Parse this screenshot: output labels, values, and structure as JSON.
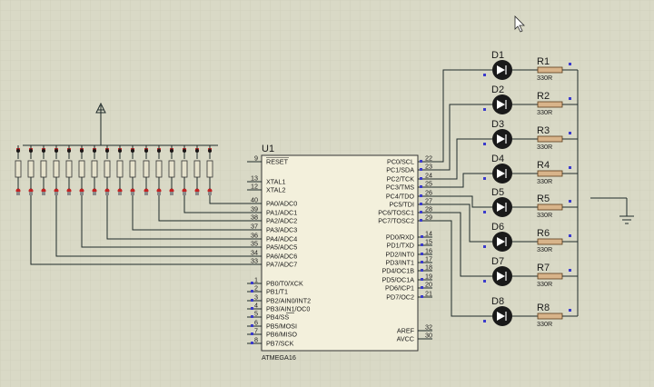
{
  "chip": {
    "ref": "U1",
    "part": "ATMEGA16",
    "left_pins": [
      {
        "num": "9",
        "name": "RESET",
        "overline": true
      },
      {
        "num": "13",
        "name": "XTAL1"
      },
      {
        "num": "12",
        "name": "XTAL2"
      },
      {
        "num": "40",
        "name": "PA0/ADC0"
      },
      {
        "num": "39",
        "name": "PA1/ADC1"
      },
      {
        "num": "38",
        "name": "PA2/ADC2"
      },
      {
        "num": "37",
        "name": "PA3/ADC3"
      },
      {
        "num": "36",
        "name": "PA4/ADC4"
      },
      {
        "num": "35",
        "name": "PA5/ADC5"
      },
      {
        "num": "34",
        "name": "PA6/ADC6"
      },
      {
        "num": "33",
        "name": "PA7/ADC7"
      },
      {
        "num": "1",
        "name": "PB0/T0/XCK"
      },
      {
        "num": "2",
        "name": "PB1/T1"
      },
      {
        "num": "3",
        "name": "PB2/AIN0/INT2"
      },
      {
        "num": "4",
        "name": "PB3/AIN1/OC0"
      },
      {
        "num": "5",
        "name": "PB4/SS",
        "overline_part": "SS"
      },
      {
        "num": "6",
        "name": "PB5/MOSI"
      },
      {
        "num": "7",
        "name": "PB6/MISO"
      },
      {
        "num": "8",
        "name": "PB7/SCK"
      }
    ],
    "right_pins": [
      {
        "num": "22",
        "name": "PC0/SCL"
      },
      {
        "num": "23",
        "name": "PC1/SDA"
      },
      {
        "num": "24",
        "name": "PC2/TCK"
      },
      {
        "num": "25",
        "name": "PC3/TMS"
      },
      {
        "num": "26",
        "name": "PC4/TDO"
      },
      {
        "num": "27",
        "name": "PC5/TDI"
      },
      {
        "num": "28",
        "name": "PC6/TOSC1"
      },
      {
        "num": "29",
        "name": "PC7/TOSC2"
      },
      {
        "num": "14",
        "name": "PD0/RXD"
      },
      {
        "num": "15",
        "name": "PD1/TXD"
      },
      {
        "num": "16",
        "name": "PD2/INT0"
      },
      {
        "num": "17",
        "name": "PD3/INT1"
      },
      {
        "num": "18",
        "name": "PD4/OC1B"
      },
      {
        "num": "19",
        "name": "PD5/OC1A"
      },
      {
        "num": "20",
        "name": "PD6/ICP1"
      },
      {
        "num": "21",
        "name": "PD7/OC2"
      },
      {
        "num": "32",
        "name": "AREF"
      },
      {
        "num": "30",
        "name": "AVCC"
      }
    ]
  },
  "leds": [
    {
      "ref": "D1",
      "res_ref": "R1",
      "res_value": "330R"
    },
    {
      "ref": "D2",
      "res_ref": "R2",
      "res_value": "330R"
    },
    {
      "ref": "D3",
      "res_ref": "R3",
      "res_value": "330R"
    },
    {
      "ref": "D4",
      "res_ref": "R4",
      "res_value": "330R"
    },
    {
      "ref": "D5",
      "res_ref": "R5",
      "res_value": "330R"
    },
    {
      "ref": "D6",
      "res_ref": "R6",
      "res_value": "330R"
    },
    {
      "ref": "D7",
      "res_ref": "R7",
      "res_value": "330R"
    },
    {
      "ref": "D8",
      "res_ref": "R8",
      "res_value": "330R"
    }
  ],
  "switch_count": 8,
  "colors": {
    "background": "#d9d9c6",
    "grid": "#c9c9b4",
    "wire": "#1f2a2a",
    "chip_body": "#f3f0dc",
    "led": "#1a1a1a",
    "marker_blue": "#3b3bcc",
    "marker_red": "#d92b2b",
    "marker_gray": "#8a8a8a"
  }
}
